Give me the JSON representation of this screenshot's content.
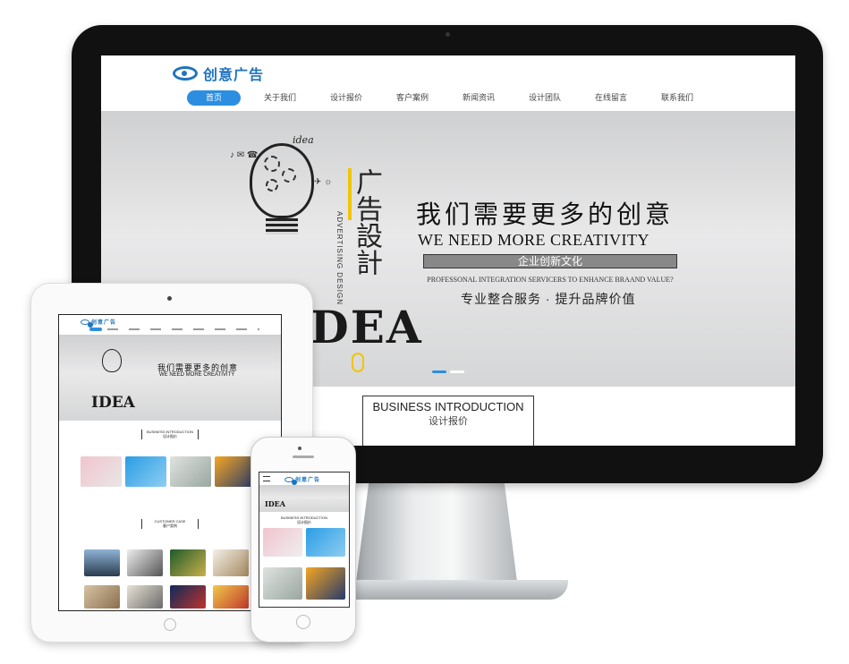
{
  "site": {
    "logo_text": "创意广告",
    "nav": [
      "首页",
      "关于我们",
      "设计报价",
      "客户案例",
      "新闻资讯",
      "设计团队",
      "在线留言",
      "联系我们"
    ]
  },
  "banner": {
    "headline_cn": "我们需要更多的创意",
    "headline_en": "WE NEED MORE CREATIVITY",
    "boxed_text": "企业创新文化",
    "sub_en": "PROFESSONAL INTEGRATION SERVICERS TO ENHANCE BRAAND VALUE?",
    "sub_cn": "专业整合服务 · 提升品牌价值",
    "vertical_cn": "广告設計",
    "vertical_en": "ADVERTISING DESIGN",
    "idea_word": "IDEA",
    "bulb_label": "idea",
    "slides": 2
  },
  "section": {
    "title_en": "BUSINESS INTRODUCTION",
    "title_cn": "设计报价"
  },
  "ipad": {
    "section2_title_en": "CUSTOMER CASE",
    "section2_title_cn": "客户案例"
  },
  "colors": {
    "brand": "#1f74bf",
    "nav_active": "#2c8ee0",
    "bezel": "#111111",
    "accent_yellow": "#f2c500"
  }
}
